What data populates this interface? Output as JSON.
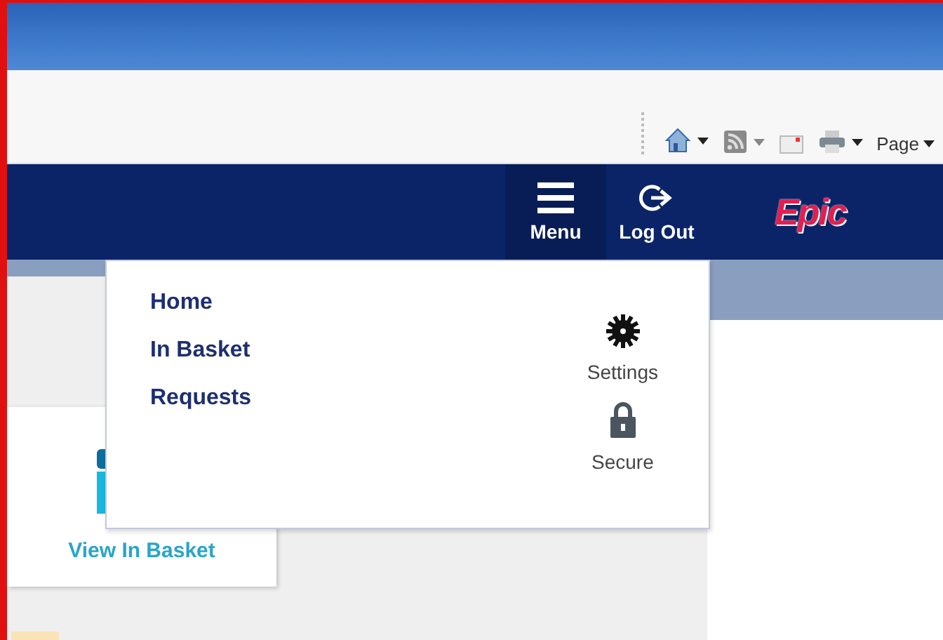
{
  "toolbar": {
    "page_button": "Page"
  },
  "header": {
    "menu": {
      "label": "Menu",
      "expanded": true
    },
    "logout_label": "Log Out",
    "logo": "Epic"
  },
  "dropdown": {
    "links": [
      "Home",
      "In Basket",
      "Requests"
    ],
    "actions": [
      {
        "kind": "settings",
        "label": "Settings"
      },
      {
        "kind": "secure",
        "label": "Secure"
      }
    ]
  },
  "card": {
    "link": "View In Basket"
  }
}
